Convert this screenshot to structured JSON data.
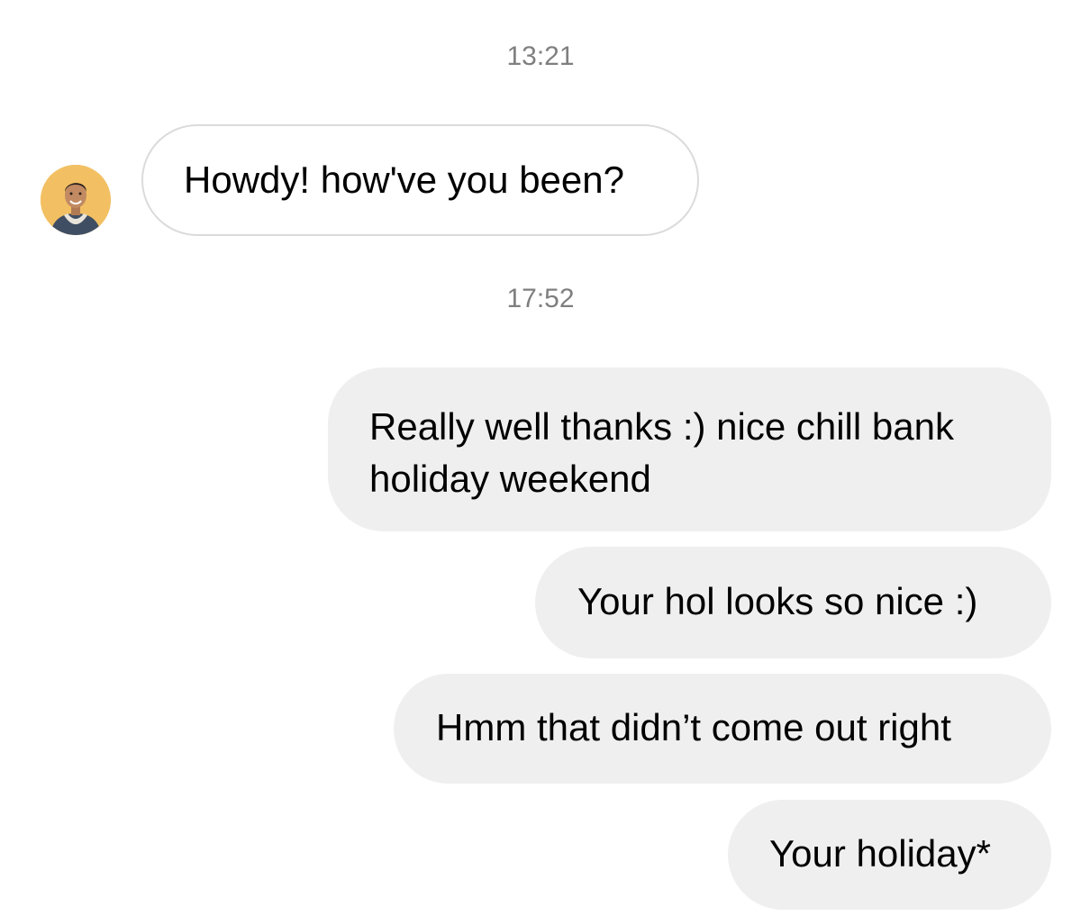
{
  "thread": {
    "timestamps": [
      "13:21",
      "17:52"
    ],
    "incoming": [
      {
        "text": "Howdy! how've you been?"
      }
    ],
    "outgoing": [
      {
        "lines": [
          "Really well thanks :) nice chill bank",
          "holiday weekend"
        ]
      },
      {
        "text": "Your hol looks so nice :)"
      },
      {
        "text": "Hmm that didn’t come out right"
      },
      {
        "text": "Your holiday*"
      }
    ]
  },
  "contact": {
    "avatar_icon": "profile-photo-avatar"
  },
  "colors": {
    "timestamp": "#7f7f7f",
    "incoming_bubble_border": "#dbdbdb",
    "outgoing_bubble_bg": "#efefef",
    "avatar_bg": "#f2c063"
  }
}
